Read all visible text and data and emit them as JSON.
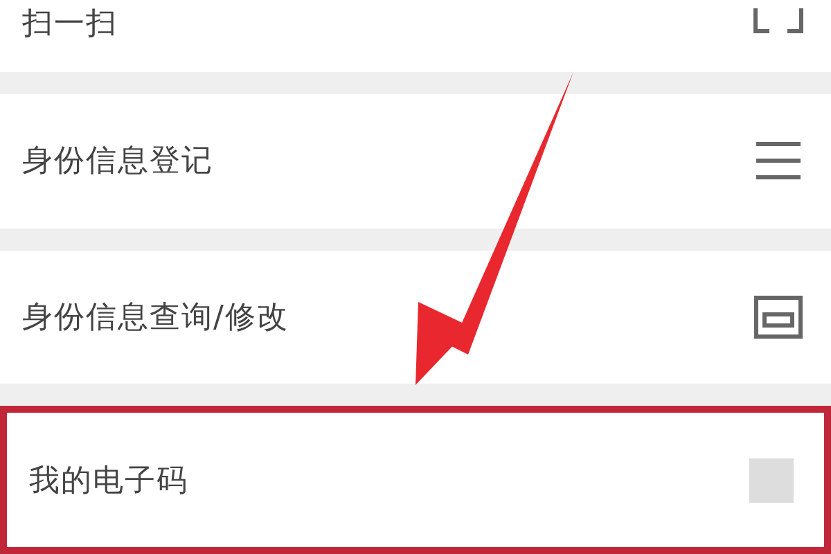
{
  "menu_items": [
    {
      "label": "扫一扫",
      "kind": "scan",
      "highlighted": false
    },
    {
      "label": "身份信息登记",
      "kind": "list",
      "highlighted": false
    },
    {
      "label": "身份信息查询/修改",
      "kind": "card",
      "highlighted": false
    },
    {
      "label": "我的电子码",
      "kind": "code",
      "highlighted": true
    }
  ]
}
